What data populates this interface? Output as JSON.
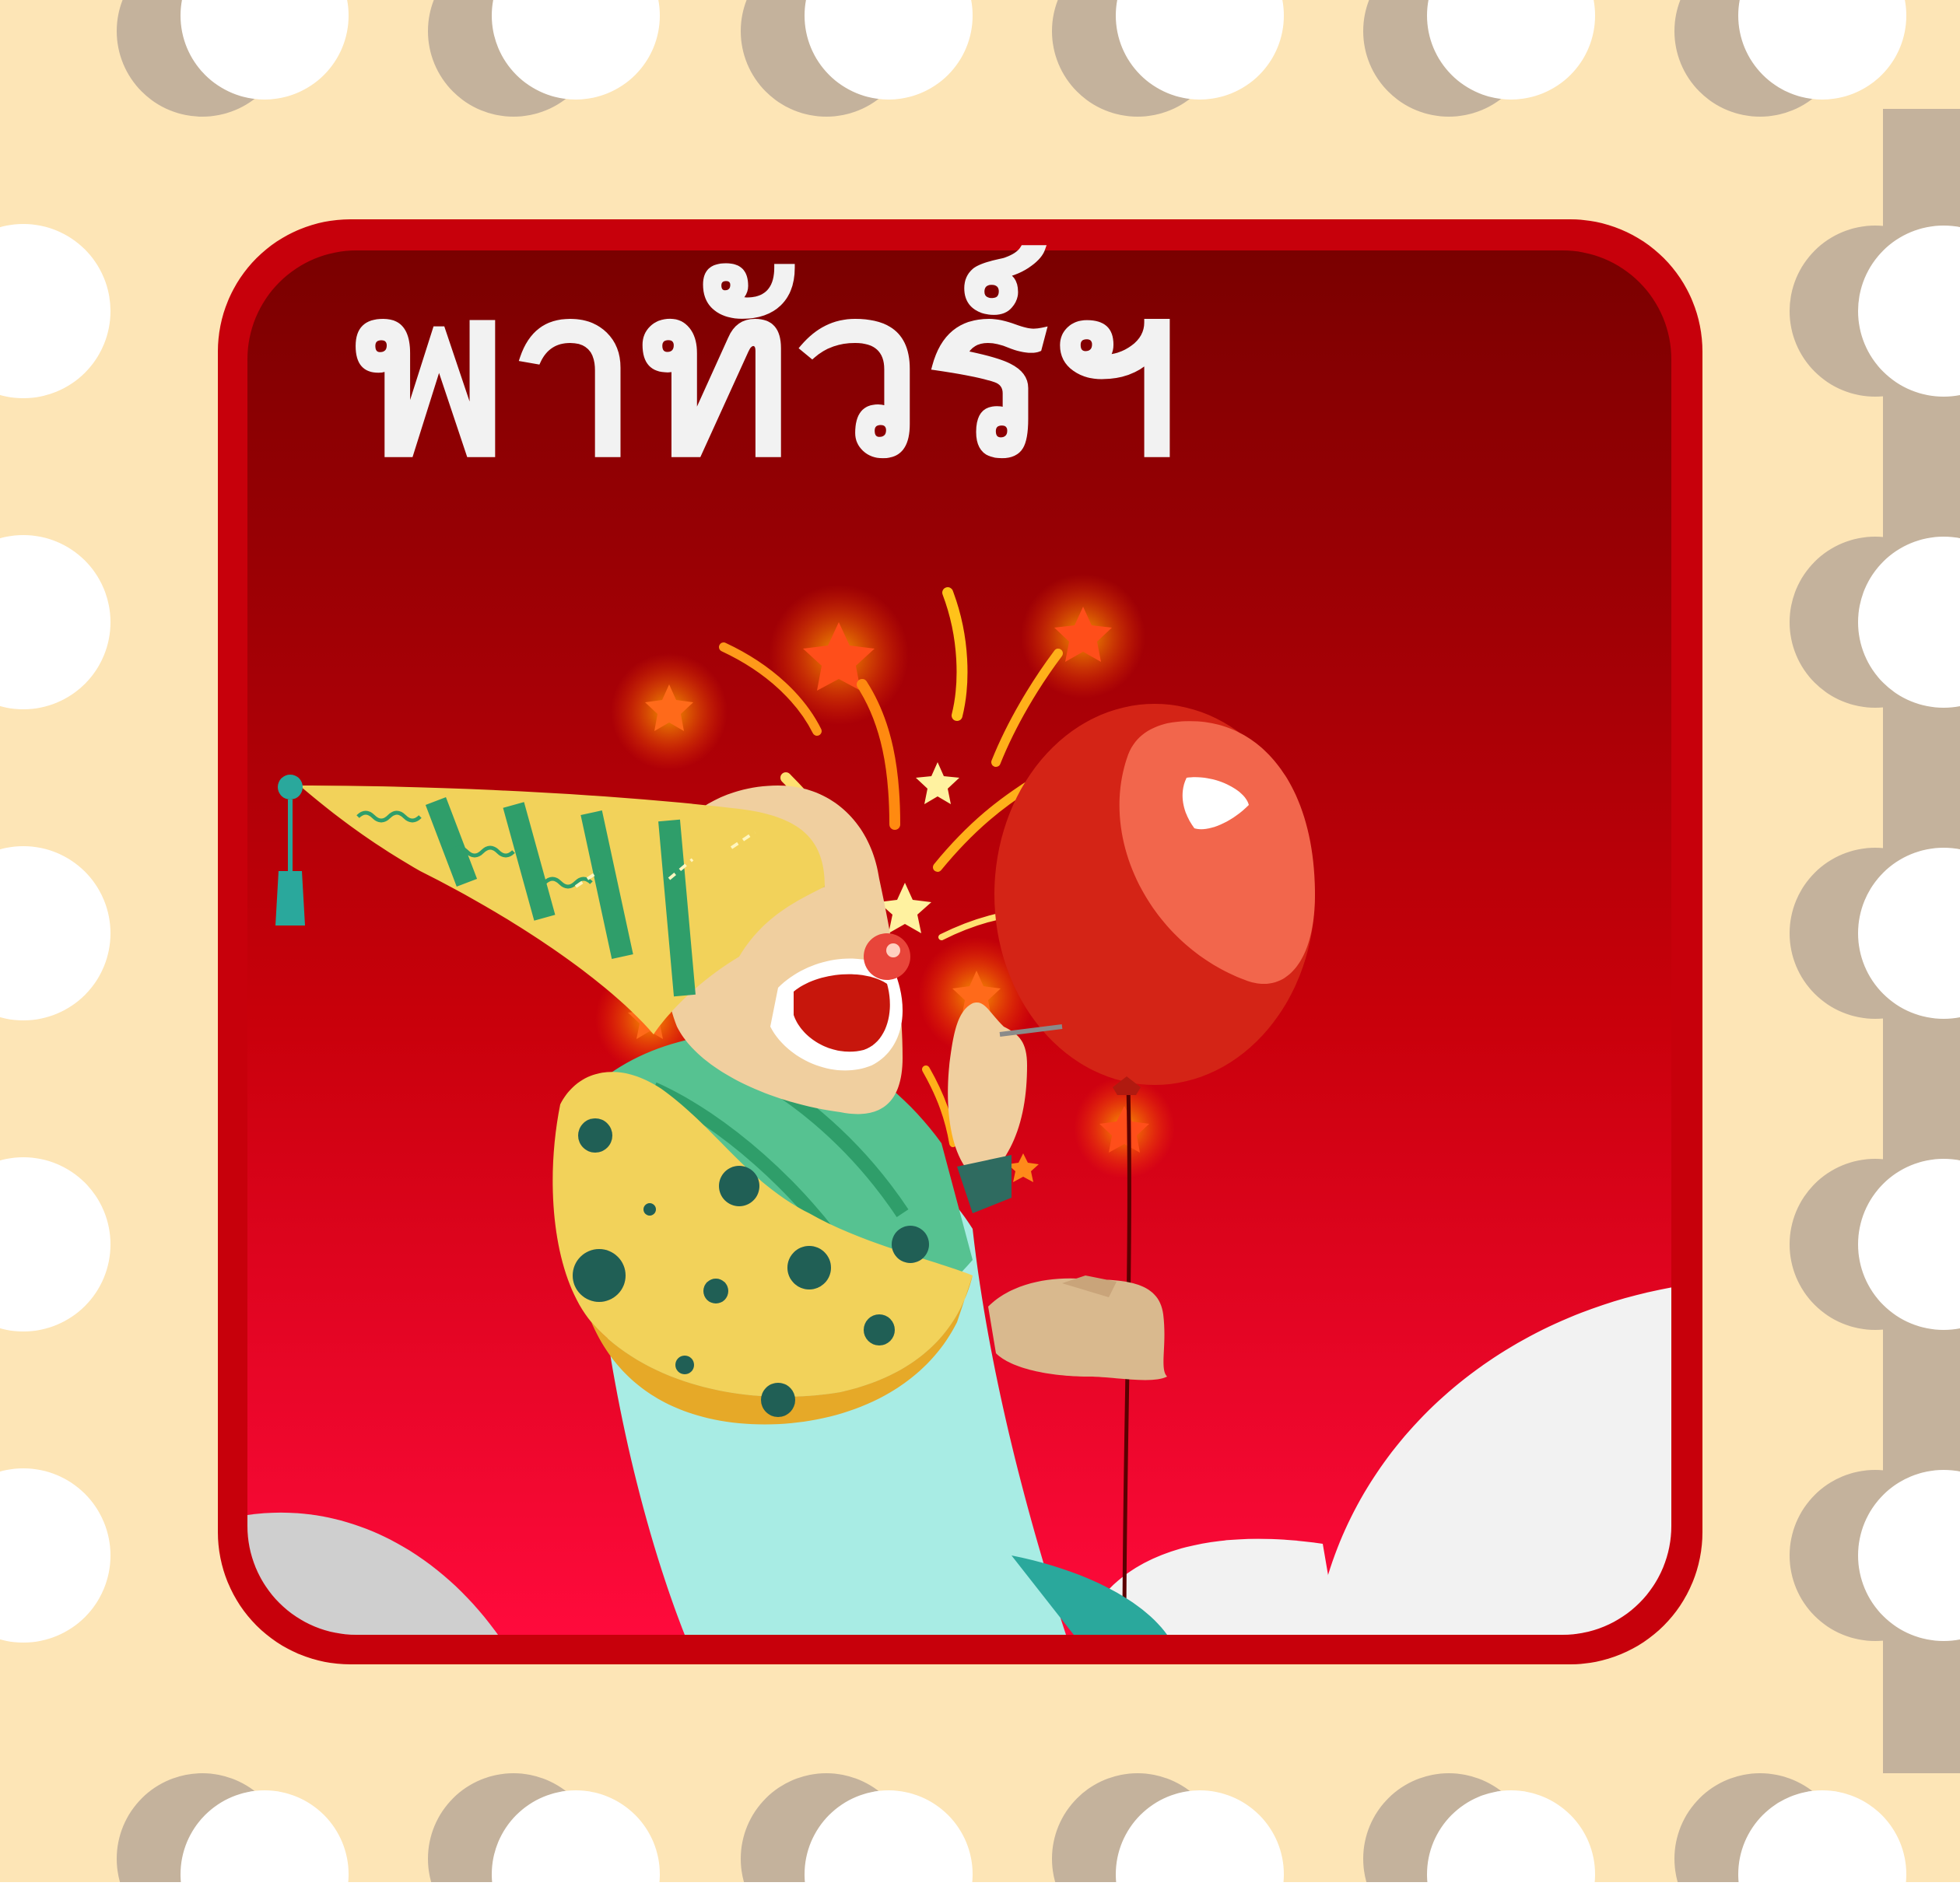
{
  "stamp": {
    "title": "พาทัวร์ฯ"
  },
  "colors": {
    "stamp_paper": "#fde5b6",
    "perforation_shadow": "#c4b29c",
    "perforation_hole": "#ffffff",
    "frame_border": "#c7000b",
    "panel_top": "#7a0000",
    "panel_bottom": "#ff0a3c",
    "title_text": "#f2f2f2",
    "cloud": "#f2f2f2",
    "balloon": "#d42416",
    "balloon_highlight": "#f2664c",
    "hat_yellow": "#f2d25a",
    "hat_green": "#3aa871",
    "shirt_mint": "#a8ece4"
  },
  "icons": {
    "mascot": "clown-mascot-icon",
    "balloon": "balloon-icon",
    "spark": "star-spark-icon"
  }
}
